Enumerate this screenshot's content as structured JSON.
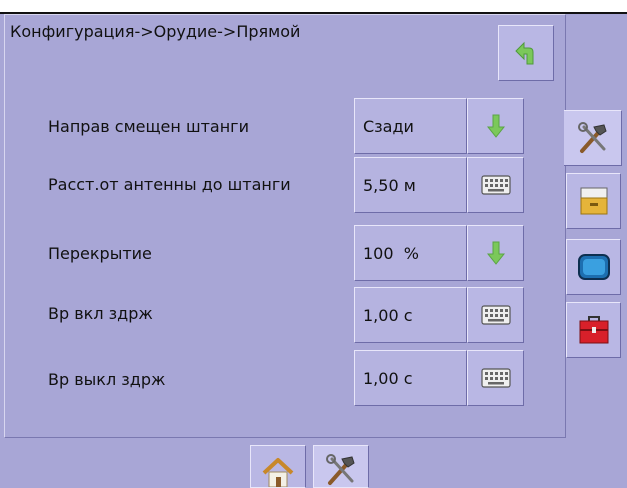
{
  "breadcrumb": "Конфигурация->Орудие->Прямой",
  "rows": [
    {
      "label": "Направ смещен штанги",
      "value": "Сзади",
      "action_icon": "arrow-down-icon"
    },
    {
      "label": "Расст.от антенны до штанги",
      "value": "5,50 м",
      "action_icon": "keyboard-icon"
    },
    {
      "label": "Перекрытие",
      "value": "100  %",
      "action_icon": "arrow-down-icon"
    },
    {
      "label": "Вр вкл здрж",
      "value": "1,00 с",
      "action_icon": "keyboard-icon"
    },
    {
      "label": "Вр выкл здрж",
      "value": "1,00 с",
      "action_icon": "keyboard-icon"
    }
  ],
  "side_tabs": [
    "tools-icon",
    "drawer-icon",
    "display-icon",
    "toolbox-icon"
  ],
  "bottom_tabs": [
    "home-icon",
    "tools-icon"
  ],
  "colors": {
    "background": "#a8a6d6",
    "arrow": "#7bc85a",
    "toolbox": "#d8202a"
  }
}
